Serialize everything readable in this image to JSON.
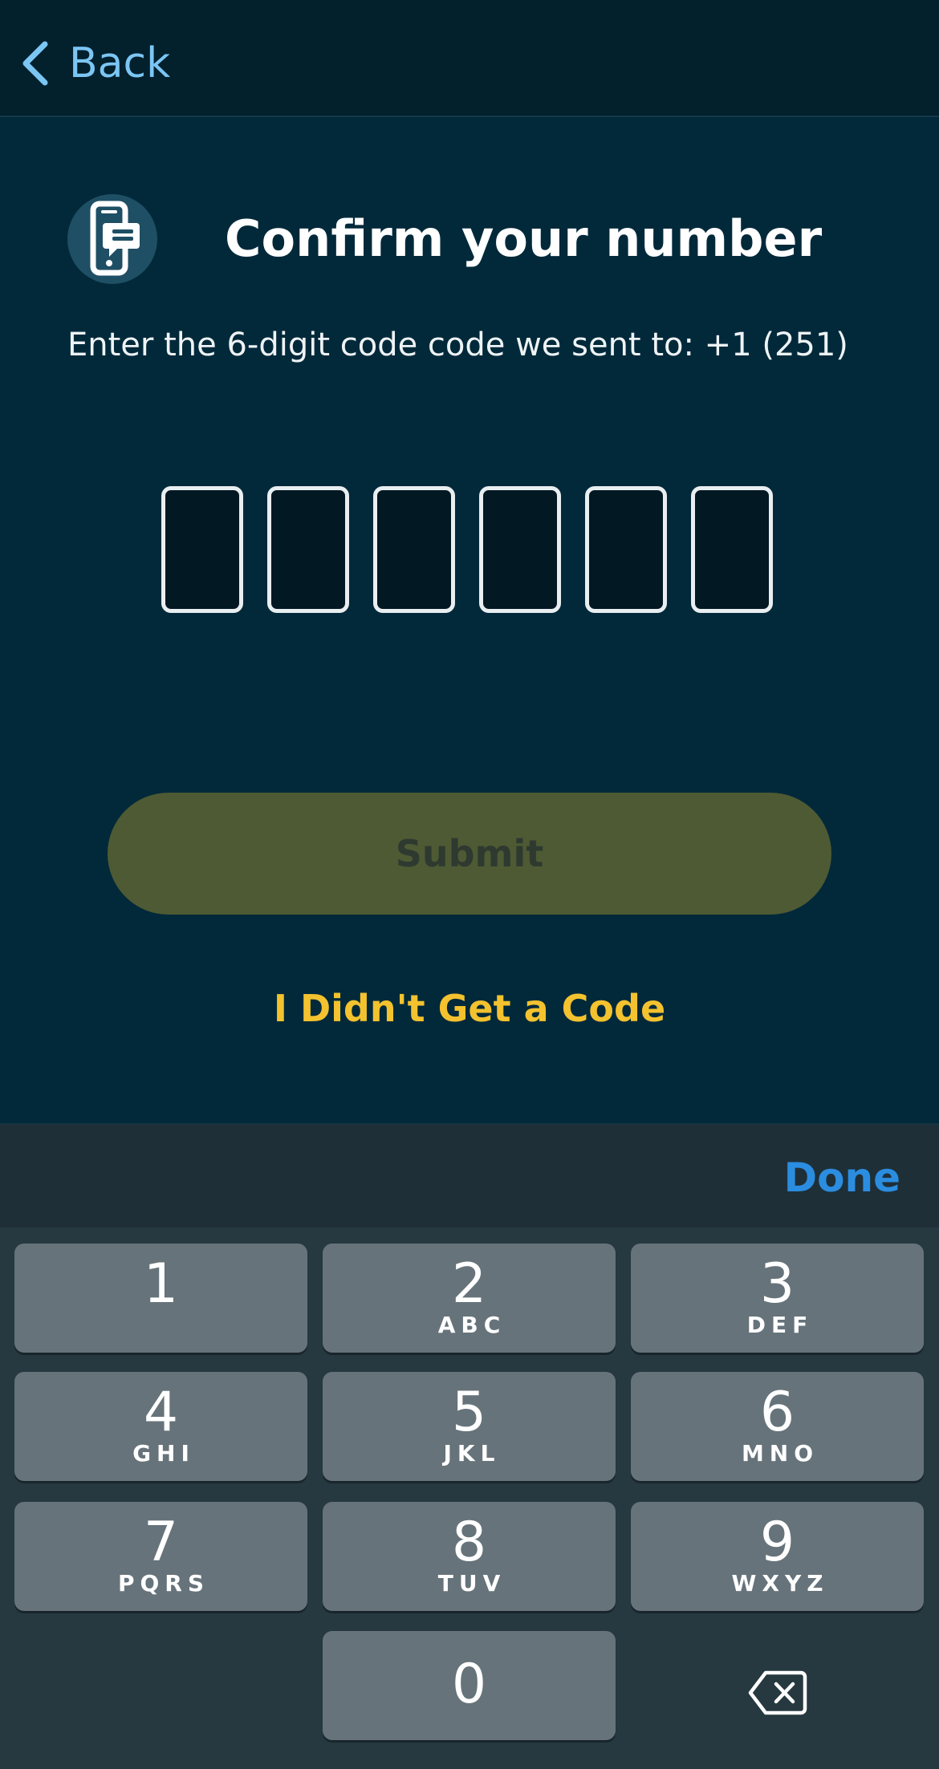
{
  "nav": {
    "back_label": "Back"
  },
  "header": {
    "icon": "phone-message-icon",
    "title": "Confirm your number",
    "subtitle": "Enter the 6-digit code code we sent to: +1 (251)"
  },
  "code": {
    "length": 6,
    "digits": [
      "",
      "",
      "",
      "",
      "",
      ""
    ]
  },
  "actions": {
    "submit_label": "Submit",
    "no_code_label": "I Didn't Get a Code"
  },
  "keyboard": {
    "done_label": "Done",
    "keys": [
      {
        "num": "1",
        "letters": ""
      },
      {
        "num": "2",
        "letters": "ABC"
      },
      {
        "num": "3",
        "letters": "DEF"
      },
      {
        "num": "4",
        "letters": "GHI"
      },
      {
        "num": "5",
        "letters": "JKL"
      },
      {
        "num": "6",
        "letters": "MNO"
      },
      {
        "num": "7",
        "letters": "PQRS"
      },
      {
        "num": "8",
        "letters": "TUV"
      },
      {
        "num": "9",
        "letters": "WXYZ"
      },
      {
        "num": "0",
        "letters": ""
      }
    ],
    "delete_icon": "backspace-icon"
  },
  "colors": {
    "background": "#02293a",
    "accent_link": "#7cc6f4",
    "submit_disabled": "#4e5a33",
    "highlight": "#f3c22e",
    "done": "#2b8de0"
  }
}
